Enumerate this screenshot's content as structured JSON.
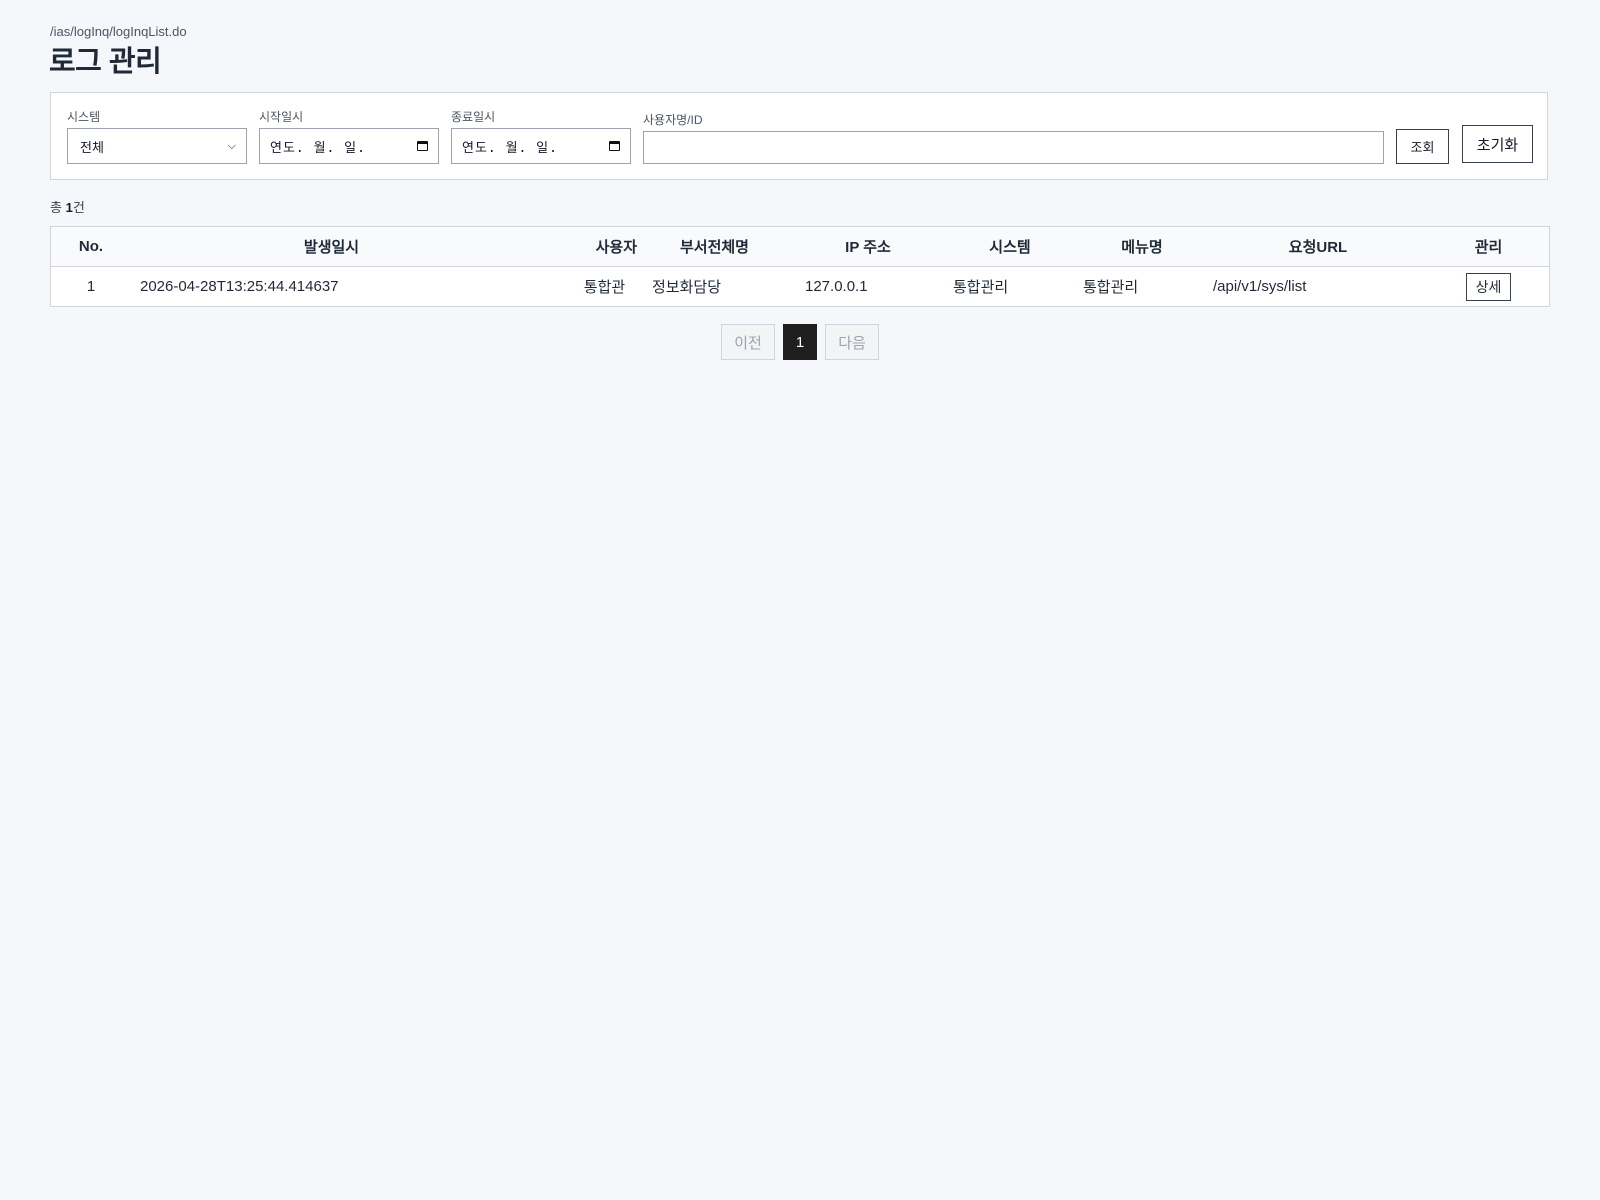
{
  "page": {
    "path": "/ias/logInq/logInqList.do",
    "title": "로그 관리"
  },
  "search": {
    "system_label": "시스템",
    "system_value": "전체",
    "start_label": "시작일시",
    "start_value": "연도. 월. 일.",
    "end_label": "종료일시",
    "end_value": "연도. 월. 일.",
    "user_label": "사용자명/ID",
    "user_value": "",
    "search_button": "조회",
    "reset_button": "초기화"
  },
  "summary": {
    "prefix": "총 ",
    "count": "1",
    "suffix": "건"
  },
  "table": {
    "columns": [
      "No.",
      "발생일시",
      "사용자",
      "부서전체명",
      "IP 주소",
      "시스템",
      "메뉴명",
      "요청URL",
      "관리"
    ],
    "rows": [
      {
        "no": "1",
        "datetime": "2026-04-28T13:25:44.414637",
        "user": "통합관",
        "dept": "정보화담당",
        "ip": "127.0.0.1",
        "system": "통합관리",
        "menu": "통합관리",
        "url": "/api/v1/sys/list",
        "action": "상세"
      }
    ]
  },
  "pagination": {
    "prev": "이전",
    "current": "1",
    "next": "다음"
  },
  "icons": {
    "select_arrow": "chevron-down-icon",
    "date_picker": "calendar-icon"
  },
  "colors": {
    "background": "#f5f7fa",
    "active_page": "#1f1f1f"
  }
}
